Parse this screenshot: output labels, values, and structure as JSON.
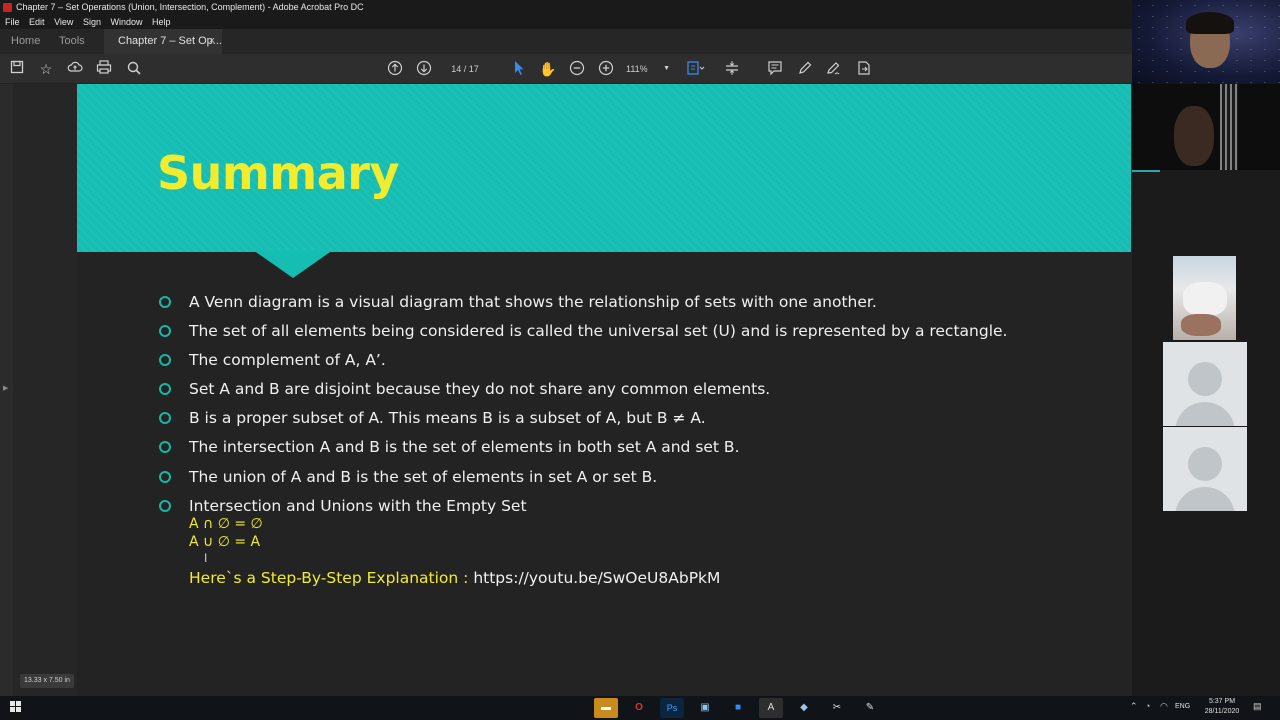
{
  "window": {
    "title": "Chapter 7 – Set Operations (Union, Intersection, Complement) - Adobe Acrobat Pro DC"
  },
  "menu": [
    "File",
    "Edit",
    "View",
    "Sign",
    "Window",
    "Help"
  ],
  "tabs": {
    "home": "Home",
    "tools": "Tools",
    "document": "Chapter 7 – Set Op...",
    "close": "×"
  },
  "toolbar": {
    "page_display": "14  /  17",
    "zoom": "111%"
  },
  "slide": {
    "title": "Summary",
    "bullets": [
      "A Venn diagram is a visual diagram that shows the relationship of sets with one another.",
      "The set of all elements being considered is called the universal set (U) and is represented by a rectangle.",
      "The complement of A, A’.",
      "Set A and B are disjoint because they do not share any common elements.",
      "B is a proper subset of A. This means B is a subset of A, but B ≠ A.",
      "The intersection A and B is the set of elements in both set A and set B.",
      "The union of A and B is the set of elements in set A or set B.",
      "Intersection and Unions with the Empty Set"
    ],
    "formulas": [
      "A ∩ ∅ = ∅",
      "A ∪ ∅ = A"
    ],
    "explanation_label": "Here`s a Step-By-Step Explanation : ",
    "explanation_url": "https://youtu.be/SwOeU8AbPkM"
  },
  "status": {
    "page_size": "13.33 x 7.50 in"
  },
  "tray": {
    "language": "ENG",
    "time": "5:37 PM",
    "date": "28/11/2020"
  },
  "colors": {
    "banner": "#15bdb2",
    "title": "#f2ec2e",
    "bullet": "#14b8a6",
    "slide_bg": "#232323"
  }
}
